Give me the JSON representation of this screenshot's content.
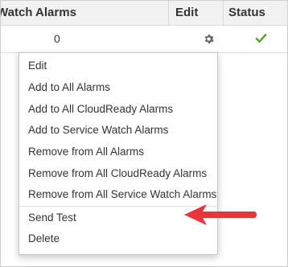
{
  "table": {
    "columns": {
      "watch_alarms": "Watch Alarms",
      "edit": "Edit",
      "status": "Status"
    },
    "row": {
      "watch_alarms_count": "0"
    }
  },
  "colors": {
    "accent_arrow": "#e8343a",
    "status_ok": "#5aa02c",
    "gear": "#666666"
  },
  "icons": {
    "edit": "gear-icon",
    "status": "checkmark-icon",
    "annotation": "red-arrow"
  },
  "menu": {
    "items": [
      {
        "label": "Edit"
      },
      {
        "label": "Add to All Alarms"
      },
      {
        "label": "Add to All CloudReady Alarms"
      },
      {
        "label": "Add to Service Watch Alarms"
      },
      {
        "label": "Remove from All Alarms"
      },
      {
        "label": "Remove from All CloudReady Alarms"
      },
      {
        "label": "Remove from All Service Watch Alarms"
      },
      {
        "label": "Send Test"
      },
      {
        "label": "Delete"
      }
    ]
  }
}
